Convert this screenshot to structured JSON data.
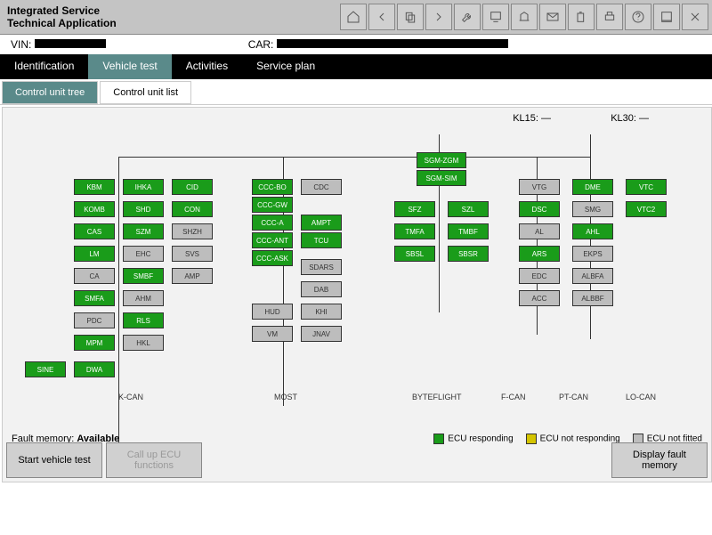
{
  "app": {
    "title": "Integrated Service\nTechnical Application"
  },
  "info": {
    "vin_label": "VIN:",
    "car_label": "CAR:"
  },
  "tabs": [
    {
      "label": "Identification",
      "active": false
    },
    {
      "label": "Vehicle test",
      "active": true
    },
    {
      "label": "Activities",
      "active": false
    },
    {
      "label": "Service plan",
      "active": false
    }
  ],
  "subtabs": [
    {
      "label": "Control unit tree",
      "active": true
    },
    {
      "label": "Control unit list",
      "active": false
    }
  ],
  "kl": {
    "kl15_label": "KL15:",
    "kl15_val": "—",
    "kl30_label": "KL30:",
    "kl30_val": "—"
  },
  "buses": {
    "kcan": "K-CAN",
    "most": "MOST",
    "byteflight": "BYTEFLIGHT",
    "fcan": "F-CAN",
    "ptcan": "PT-CAN",
    "locan": "LO-CAN"
  },
  "ecus": {
    "kbm": "KBM",
    "ihka": "IHKA",
    "cid": "CID",
    "komb": "KOMB",
    "shd": "SHD",
    "con": "CON",
    "cas": "CAS",
    "szm": "SZM",
    "shzh": "SHZH",
    "lm": "LM",
    "ehc": "EHC",
    "svs": "SVS",
    "ca": "CA",
    "smbf": "SMBF",
    "amp": "AMP",
    "smfa": "SMFA",
    "ahm": "AHM",
    "pdc": "PDC",
    "rls": "RLS",
    "mpm": "MPM",
    "hkl": "HKL",
    "sine": "SINE",
    "dwa": "DWA",
    "ccc_bo": "CCC-BO",
    "cdc": "CDC",
    "ccc_gw": "CCC-GW",
    "ccc_a": "CCC-A",
    "ampt": "AMPT",
    "ccc_ant": "CCC-ANT",
    "tcu": "TCU",
    "ccc_ask": "CCC-ASK",
    "sdars": "SDARS",
    "dab": "DAB",
    "hud": "HUD",
    "khi": "KHI",
    "vm": "VM",
    "jnav": "JNAV",
    "sgm_zgm": "SGM-ZGM",
    "sgm_sim": "SGM-SIM",
    "sfz": "SFZ",
    "szl": "SZL",
    "tmfa": "TMFA",
    "tmbf": "TMBF",
    "sbsl": "SBSL",
    "sbsr": "SBSR",
    "vtg": "VTG",
    "dme": "DME",
    "vtc": "VTC",
    "dsc": "DSC",
    "smg": "SMG",
    "vtc2": "VTC2",
    "al": "AL",
    "ahl": "AHL",
    "ars": "ARS",
    "ekps": "EKPS",
    "edc": "EDC",
    "albfa": "ALBFA",
    "acc": "ACC",
    "albbf": "ALBBF"
  },
  "fault": {
    "label": "Fault memory:",
    "value": "Available"
  },
  "legend": {
    "resp": "ECU responding",
    "notresp": "ECU not responding",
    "notfit": "ECU not fitted"
  },
  "buttons": {
    "start": "Start vehicle test",
    "callup": "Call up ECU functions",
    "display": "Display fault memory"
  },
  "colors": {
    "green": "#1a9c1a",
    "yellow": "#d4c400",
    "gray": "#bdbdbd",
    "teal": "#5a8a8a"
  }
}
